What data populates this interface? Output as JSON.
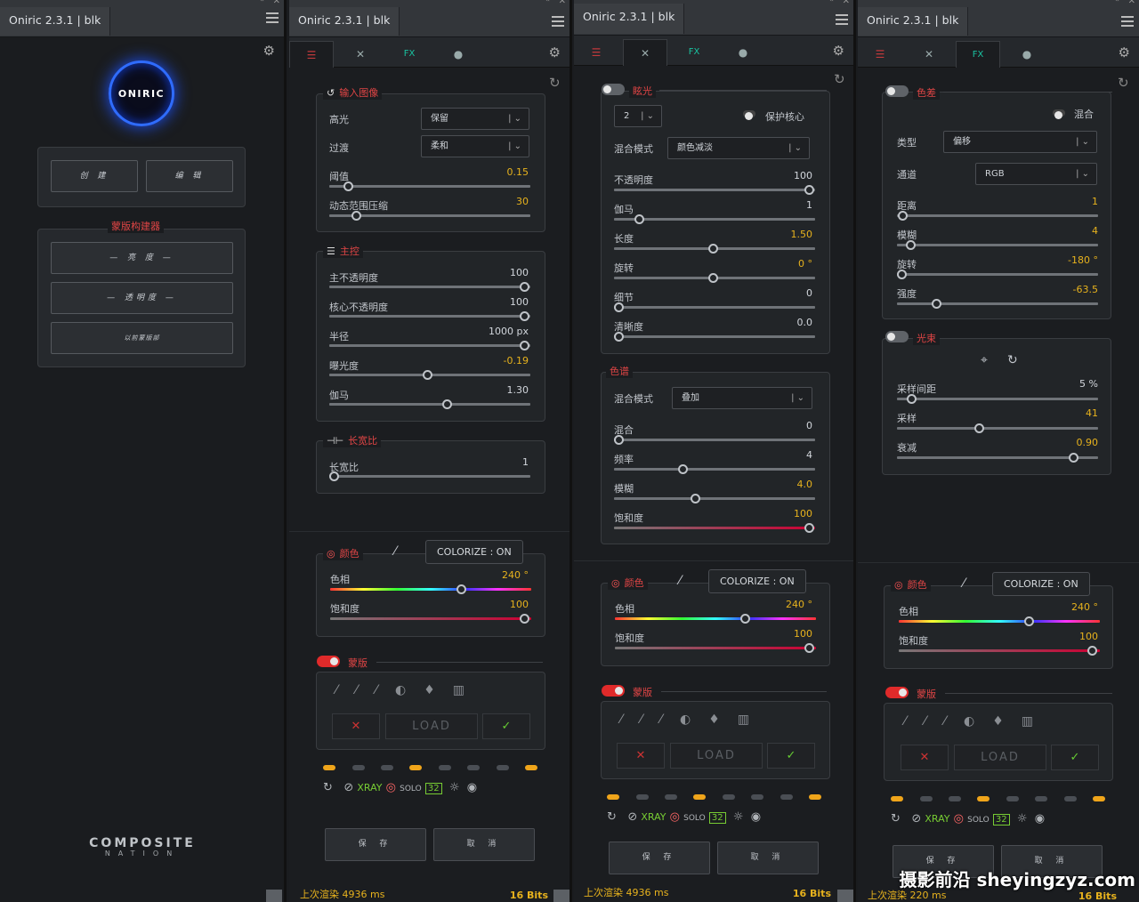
{
  "title": "Oniric 2.3.1 | blk",
  "panel1": {
    "logo": "ONIRIC",
    "btn_create": "创 建",
    "btn_edit": "编 辑",
    "builder_title": "蒙版构建器",
    "btn_brightness": "— 亮 度 —",
    "btn_transparency": "— 透明度 —",
    "btn_small": "以前蒙版部",
    "footer1": "COMPOSITE",
    "footer2": "NATION"
  },
  "panel2": {
    "input_title": "输入图像",
    "highlight_lbl": "高光",
    "highlight_val": "保留",
    "transition_lbl": "过渡",
    "transition_val": "柔和",
    "threshold_lbl": "阈值",
    "threshold_val": "0.15",
    "drc_lbl": "动态范围压缩",
    "drc_val": "30",
    "main_title": "主控",
    "main_opacity_lbl": "主不透明度",
    "main_opacity_val": "100",
    "core_opacity_lbl": "核心不透明度",
    "core_opacity_val": "100",
    "radius_lbl": "半径",
    "radius_val": "1000 px",
    "exposure_lbl": "曝光度",
    "exposure_val": "-0.19",
    "gamma_lbl": "伽马",
    "gamma_val": "1.30",
    "aspect_title": "长宽比",
    "aspect_lbl": "长宽比",
    "aspect_val": "1",
    "color_title": "颜色",
    "colorize": "COLORIZE : ON",
    "hue_lbl": "色相",
    "hue_val": "240 °",
    "sat_lbl": "饱和度",
    "sat_val": "100",
    "mask_title": "蒙版",
    "load": "LOAD",
    "xray": "XRAY",
    "solo": "SOLO",
    "bits_badge": "32",
    "save": "保 存",
    "cancel": "取 消",
    "render": "上次渲染 4936 ms",
    "bits": "16 Bits"
  },
  "panel3": {
    "glow_title": "眩光",
    "count_val": "2",
    "protect_core": "保护核心",
    "blend_lbl": "混合模式",
    "blend_val": "颜色减淡",
    "opacity_lbl": "不透明度",
    "opacity_val": "100",
    "gamma_lbl": "伽马",
    "gamma_val": "1",
    "length_lbl": "长度",
    "length_val": "1.50",
    "rotate_lbl": "旋转",
    "rotate_val": "0 °",
    "detail_lbl": "细节",
    "detail_val": "0",
    "clarity_lbl": "清晰度",
    "clarity_val": "0.0",
    "spectrum_title": "色谱",
    "blend2_lbl": "混合模式",
    "blend2_val": "叠加",
    "mix_lbl": "混合",
    "mix_val": "0",
    "freq_lbl": "频率",
    "freq_val": "4",
    "blur_lbl": "模糊",
    "blur_val": "4.0",
    "sat2_lbl": "饱和度",
    "sat2_val": "100",
    "color_title": "颜色",
    "colorize": "COLORIZE : ON",
    "hue_lbl": "色相",
    "hue_val": "240 °",
    "sat_lbl": "饱和度",
    "sat_val": "100",
    "mask_title": "蒙版",
    "load": "LOAD",
    "xray": "XRAY",
    "solo": "SOLO",
    "bits_badge": "32",
    "save": "保 存",
    "cancel": "取 消",
    "render": "上次渲染 4936 ms",
    "bits": "16 Bits"
  },
  "panel4": {
    "ca_title": "色差",
    "mix": "混合",
    "type_lbl": "类型",
    "type_val": "偏移",
    "channel_lbl": "通道",
    "channel_val": "RGB",
    "distance_lbl": "距离",
    "distance_val": "1",
    "blur_lbl": "模糊",
    "blur_val": "4",
    "rotate_lbl": "旋转",
    "rotate_val": "-180 °",
    "strength_lbl": "强度",
    "strength_val": "-63.5",
    "beam_title": "光束",
    "spacing_lbl": "采样间距",
    "spacing_val": "5 %",
    "samples_lbl": "采样",
    "samples_val": "41",
    "decay_lbl": "衰减",
    "decay_val": "0.90",
    "color_title": "颜色",
    "colorize": "COLORIZE : ON",
    "hue_lbl": "色相",
    "hue_val": "240 °",
    "sat_lbl": "饱和度",
    "sat_val": "100",
    "mask_title": "蒙版",
    "load": "LOAD",
    "xray": "XRAY",
    "solo": "SOLO",
    "bits_badge": "32",
    "save": "保 存",
    "cancel": "取 消",
    "render": "上次渲染 220 ms",
    "bits": "16 Bits"
  },
  "watermark": "摄影前沿 sheyingzyz.com"
}
